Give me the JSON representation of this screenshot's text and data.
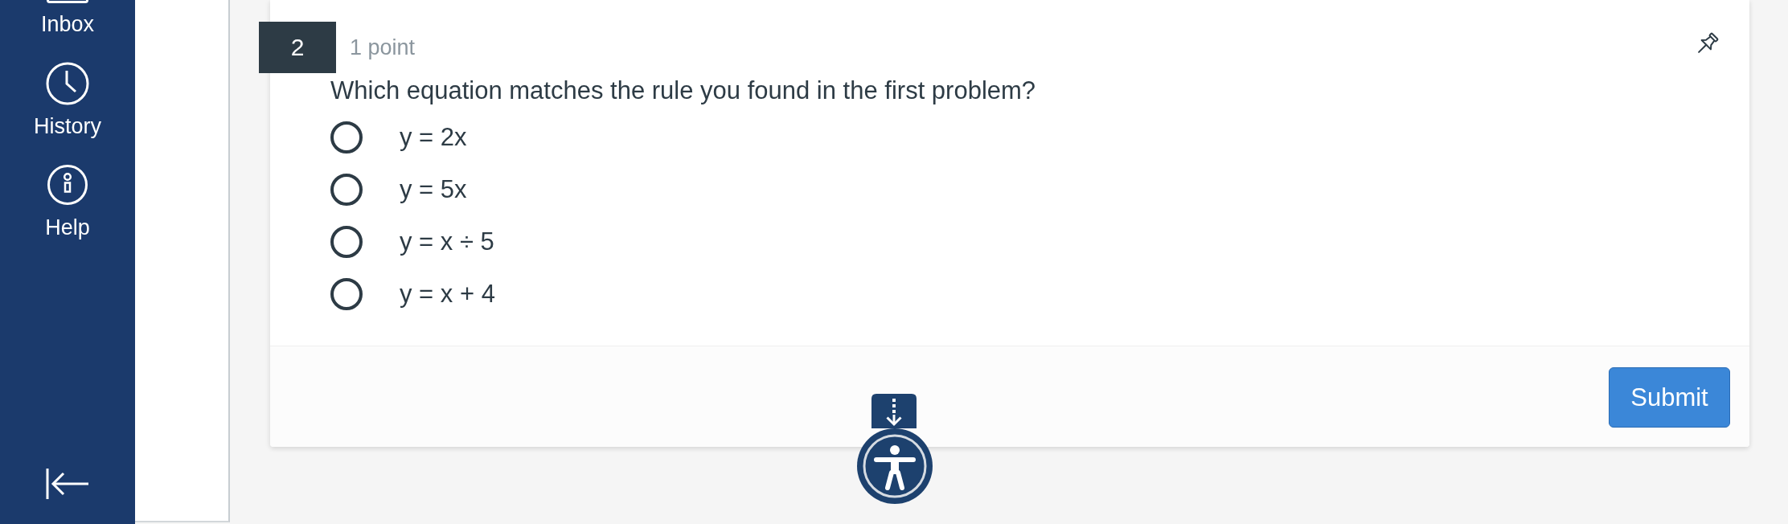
{
  "sidebar": {
    "items": [
      {
        "label": "Inbox"
      },
      {
        "label": "History"
      },
      {
        "label": "Help"
      }
    ]
  },
  "question": {
    "number": "2",
    "points": "1 point",
    "text": "Which equation matches the rule you found in the first problem?",
    "options": [
      {
        "label": "y = 2x",
        "selected": false
      },
      {
        "label": "y = 5x",
        "selected": false
      },
      {
        "label": "y = x ÷ 5",
        "selected": false
      },
      {
        "label": "y = x + 4",
        "selected": false
      }
    ]
  },
  "footer": {
    "submit": "Submit"
  }
}
